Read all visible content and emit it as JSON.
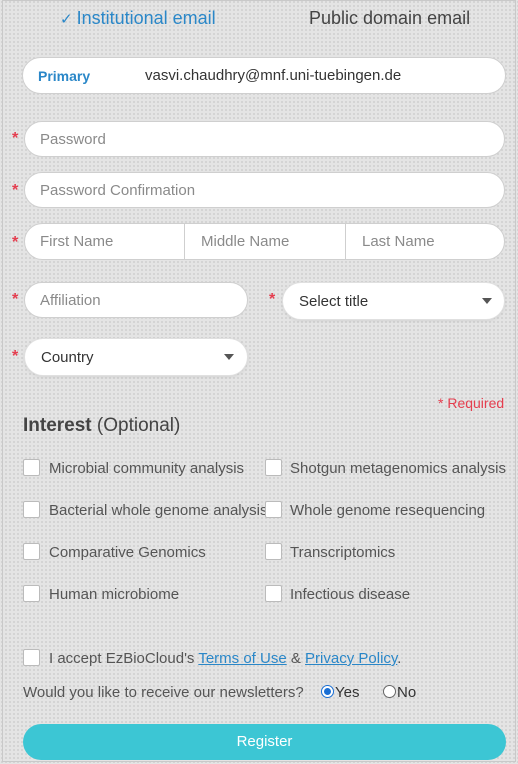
{
  "tabs": {
    "institutional": "Institutional email",
    "public": "Public domain email"
  },
  "primary": {
    "label": "Primary",
    "email": "vasvi.chaudhry@mnf.uni-tuebingen.de"
  },
  "fields": {
    "password": "Password",
    "password_confirmation": "Password Confirmation",
    "first_name": "First Name",
    "middle_name": "Middle Name",
    "last_name": "Last Name",
    "affiliation": "Affiliation",
    "title_select": "Select title",
    "country_select": "Country"
  },
  "required_marker": "*",
  "required_note": "* Required",
  "interest": {
    "title_bold": "Interest",
    "title_rest": " (Optional)",
    "options": [
      "Microbial community analysis",
      "Shotgun metagenomics analysis",
      "Bacterial whole genome analysis",
      "Whole genome resequencing",
      "Comparative Genomics",
      "Transcriptomics",
      "Human microbiome",
      "Infectious disease"
    ]
  },
  "terms": {
    "prefix": "I accept EzBioCloud's ",
    "terms_link": "Terms of Use",
    "amp": " & ",
    "privacy_link": "Privacy Policy",
    "suffix": "."
  },
  "newsletter": {
    "question": "Would you like to receive our newsletters?",
    "yes": "Yes",
    "no": "No",
    "selected": "Yes"
  },
  "register_label": "Register",
  "colors": {
    "accent": "#2a87c8",
    "required": "#e53e4f",
    "button": "#3cc6d4"
  }
}
